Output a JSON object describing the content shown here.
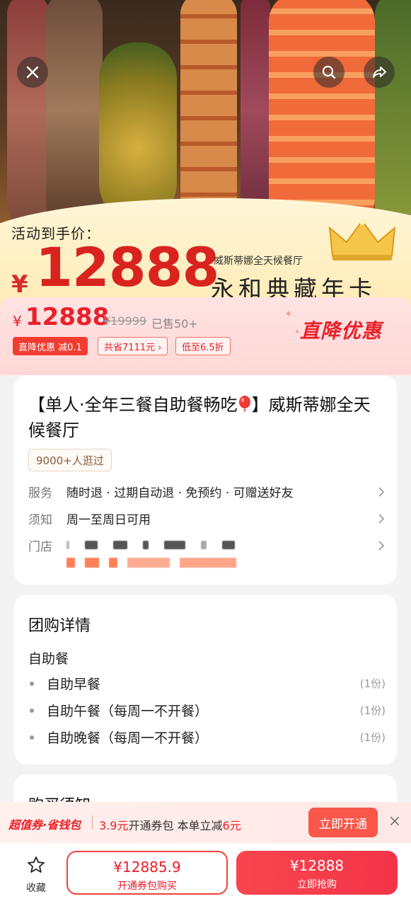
{
  "hero": {
    "activity_label": "活动到手价：",
    "yen": "¥",
    "price": "12888",
    "restaurant": "威斯蒂娜全天候餐厅",
    "card_title": "永和典藏年卡"
  },
  "price_strip": {
    "yen": "¥",
    "price": "12888",
    "original_price": "¥19999",
    "sold": "已售50+",
    "tag_discount": "直降优惠 减0.1",
    "tag_save": "共省7111元 ›",
    "tag_low": "低至6.5折",
    "direct_discount": "直降优惠"
  },
  "product": {
    "title": "【单人·全年三餐自助餐畅吃",
    "title_tail": "】威斯蒂娜全天候餐厅",
    "visits": "9000+人逛过",
    "service_label": "服务",
    "service_value": "随时退 · 过期自动退 · 免预约 · 可赠送好友",
    "notice_label": "须知",
    "notice_value": "周一至周日可用",
    "store_label": "门店"
  },
  "details": {
    "section_title": "团购详情",
    "category": "自助餐",
    "items": [
      {
        "name": "自助早餐",
        "qty": "(1份)"
      },
      {
        "name": "自助午餐（每周一不开餐）",
        "qty": "(1份)"
      },
      {
        "name": "自助晚餐（每周一不开餐）",
        "qty": "(1份)"
      }
    ]
  },
  "purchase_notes": {
    "title": "购买须知"
  },
  "promo": {
    "brand": "超值券·省钱包",
    "price": "3.9元",
    "text_a": "开通券包 本单立减",
    "reduce": "6元",
    "button": "立即开通"
  },
  "bottom": {
    "favorite": "收藏",
    "coupon_price": "¥12885.9",
    "coupon_label": "开通券包购买",
    "buy_price": "¥12888",
    "buy_label": "立即抢购"
  },
  "colors": {
    "accent": "#e9202a",
    "gold": "#f3c96b",
    "background": "#f3f3f3"
  }
}
